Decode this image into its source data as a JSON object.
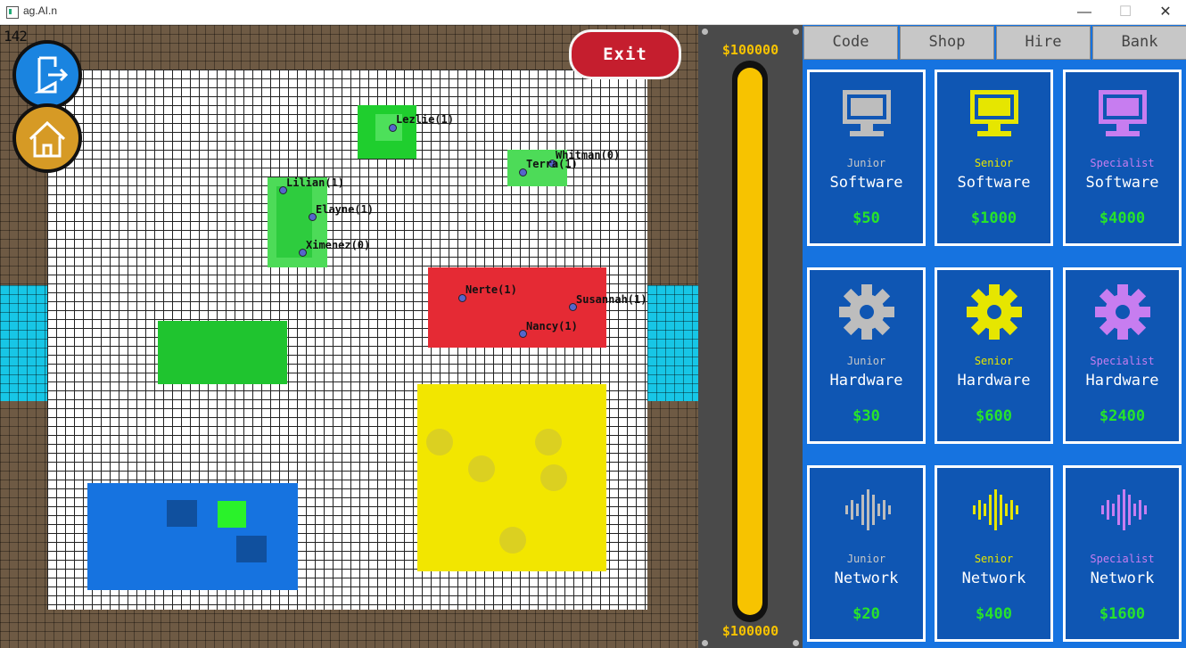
{
  "window": {
    "title": "ag.AI.n",
    "minimize": "—",
    "maximize": "☐",
    "close": "✕"
  },
  "hud": {
    "counter": "142",
    "exit_label": "Exit"
  },
  "agents": [
    {
      "name": "Lezlie(1)"
    },
    {
      "name": "Whitman(0)"
    },
    {
      "name": "Terra(1)"
    },
    {
      "name": "Lilian(1)"
    },
    {
      "name": "Elayne(1)"
    },
    {
      "name": "Ximenez(0)"
    },
    {
      "name": "Nerte(1)"
    },
    {
      "name": "Susannah(1)"
    },
    {
      "name": "Nancy(1)"
    }
  ],
  "budget": {
    "top_value": "$100000",
    "bottom_value": "$100000",
    "fill_fraction": 1.0,
    "color": "#f7c300"
  },
  "tabs": [
    "Code",
    "Shop",
    "Hire",
    "Bank"
  ],
  "cards": [
    {
      "level": "Junior",
      "type": "Software",
      "price": "$50",
      "icon": "monitor-icon",
      "color": "#bdbdbd"
    },
    {
      "level": "Senior",
      "type": "Software",
      "price": "$1000",
      "icon": "monitor-icon",
      "color": "#e6e600"
    },
    {
      "level": "Specialist",
      "type": "Software",
      "price": "$4000",
      "icon": "monitor-icon",
      "color": "#c77df0"
    },
    {
      "level": "Junior",
      "type": "Hardware",
      "price": "$30",
      "icon": "gear-icon",
      "color": "#bdbdbd"
    },
    {
      "level": "Senior",
      "type": "Hardware",
      "price": "$600",
      "icon": "gear-icon",
      "color": "#e6e600"
    },
    {
      "level": "Specialist",
      "type": "Hardware",
      "price": "$2400",
      "icon": "gear-icon",
      "color": "#c77df0"
    },
    {
      "level": "Junior",
      "type": "Network",
      "price": "$20",
      "icon": "soundwave-icon",
      "color": "#bdbdbd"
    },
    {
      "level": "Senior",
      "type": "Network",
      "price": "$400",
      "icon": "soundwave-icon",
      "color": "#e6e600"
    },
    {
      "level": "Specialist",
      "type": "Network",
      "price": "$1600",
      "icon": "soundwave-icon",
      "color": "#c77df0"
    }
  ]
}
